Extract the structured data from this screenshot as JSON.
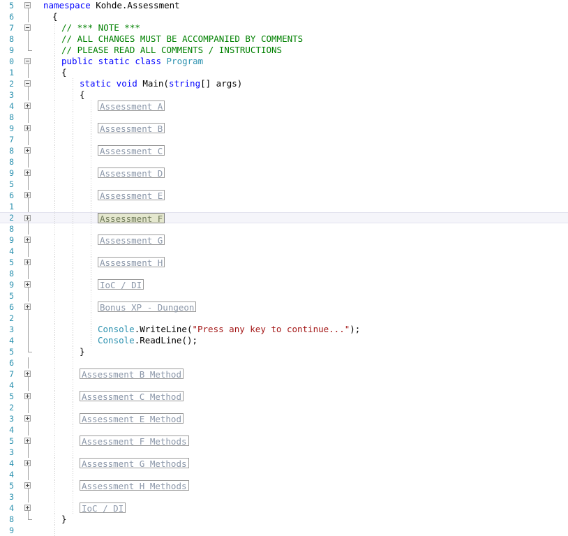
{
  "editor": {
    "app": "visual-studio-code-editor",
    "language": "csharp",
    "colors": {
      "background": "#ffffff",
      "keyword": "#0000ff",
      "type": "#2b91af",
      "comment": "#008000",
      "string": "#a31515",
      "plain": "#000000",
      "line_number": "#2b91af",
      "collapsed_text": "#8a96a8",
      "collapsed_border": "#9a9a9a",
      "current_line_background": "#f5f5fa",
      "current_line_border": "#e3e3ef",
      "selected_collapsed_background": "#e4e7ce",
      "fold_glyph": "#a0a0a0",
      "indent_guide": "#d0d0d0"
    },
    "icons": {
      "fold_collapse": "minus-box-icon",
      "fold_expand": "plus-box-icon"
    },
    "lines": [
      {
        "num": "5",
        "fold": "minus",
        "guides": [],
        "indent": 0,
        "type": "code",
        "segments": [
          {
            "c": "kw",
            "t": "namespace"
          },
          {
            "c": "pl",
            "t": " Kohde.Assessment"
          }
        ]
      },
      {
        "num": "6",
        "fold": "line",
        "guides": [],
        "indent": 1,
        "type": "code",
        "segments": [
          {
            "c": "pl",
            "t": "{"
          }
        ]
      },
      {
        "num": "7",
        "fold": "minus",
        "guides": [
          78
        ],
        "indent": 2,
        "type": "code",
        "segments": [
          {
            "c": "cm",
            "t": "// *** NOTE ***"
          }
        ]
      },
      {
        "num": "8",
        "fold": "line",
        "guides": [
          78
        ],
        "indent": 2,
        "type": "code",
        "segments": [
          {
            "c": "cm",
            "t": "// ALL CHANGES MUST BE ACCOMPANIED BY COMMENTS"
          }
        ]
      },
      {
        "num": "9",
        "fold": "elbow",
        "guides": [
          78
        ],
        "indent": 2,
        "type": "code",
        "segments": [
          {
            "c": "cm",
            "t": "// PLEASE READ ALL COMMENTS / INSTRUCTIONS"
          }
        ]
      },
      {
        "num": "0",
        "fold": "minus",
        "guides": [
          78
        ],
        "indent": 2,
        "type": "code",
        "segments": [
          {
            "c": "kw",
            "t": "public static class"
          },
          {
            "c": "ty",
            "t": " Program"
          }
        ]
      },
      {
        "num": "1",
        "fold": "line",
        "guides": [
          78
        ],
        "indent": 2,
        "type": "code",
        "segments": [
          {
            "c": "pl",
            "t": "{"
          }
        ]
      },
      {
        "num": "2",
        "fold": "minus",
        "guides": [
          78,
          104
        ],
        "indent": 4,
        "type": "code",
        "segments": [
          {
            "c": "kw",
            "t": "static void"
          },
          {
            "c": "pl",
            "t": " Main("
          },
          {
            "c": "kw",
            "t": "string"
          },
          {
            "c": "pl",
            "t": "[] args)"
          }
        ]
      },
      {
        "num": "3",
        "fold": "line",
        "guides": [
          78,
          104
        ],
        "indent": 4,
        "type": "code",
        "segments": [
          {
            "c": "pl",
            "t": "{"
          }
        ]
      },
      {
        "num": "4",
        "fold": "plus",
        "guides": [
          78,
          104,
          130
        ],
        "indent": 6,
        "type": "collapsed",
        "text": "Assessment A"
      },
      {
        "num": "8",
        "fold": "line",
        "guides": [
          78,
          104,
          130
        ],
        "indent": 6,
        "type": "blank"
      },
      {
        "num": "9",
        "fold": "plus",
        "guides": [
          78,
          104,
          130
        ],
        "indent": 6,
        "type": "collapsed",
        "text": "Assessment B"
      },
      {
        "num": "7",
        "fold": "line",
        "guides": [
          78,
          104,
          130
        ],
        "indent": 6,
        "type": "blank"
      },
      {
        "num": "8",
        "fold": "plus",
        "guides": [
          78,
          104,
          130
        ],
        "indent": 6,
        "type": "collapsed",
        "text": "Assessment C"
      },
      {
        "num": "8",
        "fold": "line",
        "guides": [
          78,
          104,
          130
        ],
        "indent": 6,
        "type": "blank"
      },
      {
        "num": "9",
        "fold": "plus",
        "guides": [
          78,
          104,
          130
        ],
        "indent": 6,
        "type": "collapsed",
        "text": "Assessment D"
      },
      {
        "num": "5",
        "fold": "line",
        "guides": [
          78,
          104,
          130
        ],
        "indent": 6,
        "type": "blank"
      },
      {
        "num": "6",
        "fold": "plus",
        "guides": [
          78,
          104,
          130
        ],
        "indent": 6,
        "type": "collapsed",
        "text": "Assessment E"
      },
      {
        "num": "1",
        "fold": "line",
        "guides": [
          78,
          104,
          130
        ],
        "indent": 6,
        "type": "blank"
      },
      {
        "num": "2",
        "fold": "plus",
        "guides": [
          78,
          104,
          130
        ],
        "indent": 6,
        "type": "collapsed",
        "text": "Assessment F",
        "current": true
      },
      {
        "num": "8",
        "fold": "line",
        "guides": [
          78,
          104,
          130
        ],
        "indent": 6,
        "type": "blank"
      },
      {
        "num": "9",
        "fold": "plus",
        "guides": [
          78,
          104,
          130
        ],
        "indent": 6,
        "type": "collapsed",
        "text": "Assessment G"
      },
      {
        "num": "4",
        "fold": "line",
        "guides": [
          78,
          104,
          130
        ],
        "indent": 6,
        "type": "blank"
      },
      {
        "num": "5",
        "fold": "plus",
        "guides": [
          78,
          104,
          130
        ],
        "indent": 6,
        "type": "collapsed",
        "text": "Assessment H"
      },
      {
        "num": "8",
        "fold": "line",
        "guides": [
          78,
          104,
          130
        ],
        "indent": 6,
        "type": "blank"
      },
      {
        "num": "9",
        "fold": "plus",
        "guides": [
          78,
          104,
          130
        ],
        "indent": 6,
        "type": "collapsed",
        "text": "IoC / DI"
      },
      {
        "num": "5",
        "fold": "line",
        "guides": [
          78,
          104,
          130
        ],
        "indent": 6,
        "type": "blank"
      },
      {
        "num": "6",
        "fold": "plus",
        "guides": [
          78,
          104,
          130
        ],
        "indent": 6,
        "type": "collapsed",
        "text": "Bonus XP - Dungeon"
      },
      {
        "num": "2",
        "fold": "line",
        "guides": [
          78,
          104,
          130
        ],
        "indent": 6,
        "type": "blank"
      },
      {
        "num": "3",
        "fold": "line",
        "guides": [
          78,
          104,
          130
        ],
        "indent": 6,
        "type": "code",
        "segments": [
          {
            "c": "ty",
            "t": "Console"
          },
          {
            "c": "pl",
            "t": ".WriteLine("
          },
          {
            "c": "st",
            "t": "\"Press any key to continue...\""
          },
          {
            "c": "pl",
            "t": ");"
          }
        ]
      },
      {
        "num": "4",
        "fold": "line",
        "guides": [
          78,
          104,
          130
        ],
        "indent": 6,
        "type": "code",
        "segments": [
          {
            "c": "ty",
            "t": "Console"
          },
          {
            "c": "pl",
            "t": ".ReadLine();"
          }
        ]
      },
      {
        "num": "5",
        "fold": "elbow",
        "guides": [
          78,
          104
        ],
        "indent": 4,
        "type": "code",
        "segments": [
          {
            "c": "pl",
            "t": "}"
          }
        ]
      },
      {
        "num": "6",
        "fold": "line",
        "guides": [
          78,
          104
        ],
        "indent": 4,
        "type": "blank"
      },
      {
        "num": "7",
        "fold": "plus",
        "guides": [
          78,
          104
        ],
        "indent": 4,
        "type": "collapsed",
        "text": "Assessment B Method"
      },
      {
        "num": "4",
        "fold": "line",
        "guides": [
          78,
          104
        ],
        "indent": 4,
        "type": "blank"
      },
      {
        "num": "5",
        "fold": "plus",
        "guides": [
          78,
          104
        ],
        "indent": 4,
        "type": "collapsed",
        "text": "Assessment C Method"
      },
      {
        "num": "2",
        "fold": "line",
        "guides": [
          78,
          104
        ],
        "indent": 4,
        "type": "blank"
      },
      {
        "num": "3",
        "fold": "plus",
        "guides": [
          78,
          104
        ],
        "indent": 4,
        "type": "collapsed",
        "text": "Assessment E Method"
      },
      {
        "num": "4",
        "fold": "line",
        "guides": [
          78,
          104
        ],
        "indent": 4,
        "type": "blank"
      },
      {
        "num": "5",
        "fold": "plus",
        "guides": [
          78,
          104
        ],
        "indent": 4,
        "type": "collapsed",
        "text": "Assessment F Methods"
      },
      {
        "num": "3",
        "fold": "line",
        "guides": [
          78,
          104
        ],
        "indent": 4,
        "type": "blank"
      },
      {
        "num": "4",
        "fold": "plus",
        "guides": [
          78,
          104
        ],
        "indent": 4,
        "type": "collapsed",
        "text": "Assessment G Methods"
      },
      {
        "num": "4",
        "fold": "line",
        "guides": [
          78,
          104
        ],
        "indent": 4,
        "type": "blank"
      },
      {
        "num": "5",
        "fold": "plus",
        "guides": [
          78,
          104
        ],
        "indent": 4,
        "type": "collapsed",
        "text": "Assessment H Methods"
      },
      {
        "num": "3",
        "fold": "line",
        "guides": [
          78,
          104
        ],
        "indent": 4,
        "type": "blank"
      },
      {
        "num": "4",
        "fold": "plus",
        "guides": [
          78,
          104
        ],
        "indent": 4,
        "type": "collapsed",
        "text": "IoC / DI"
      },
      {
        "num": "8",
        "fold": "elbow",
        "guides": [
          78
        ],
        "indent": 2,
        "type": "code",
        "segments": [
          {
            "c": "pl",
            "t": "}"
          }
        ]
      },
      {
        "num": "9",
        "fold": "none",
        "guides": [
          78
        ],
        "indent": 2,
        "type": "blank"
      }
    ]
  }
}
